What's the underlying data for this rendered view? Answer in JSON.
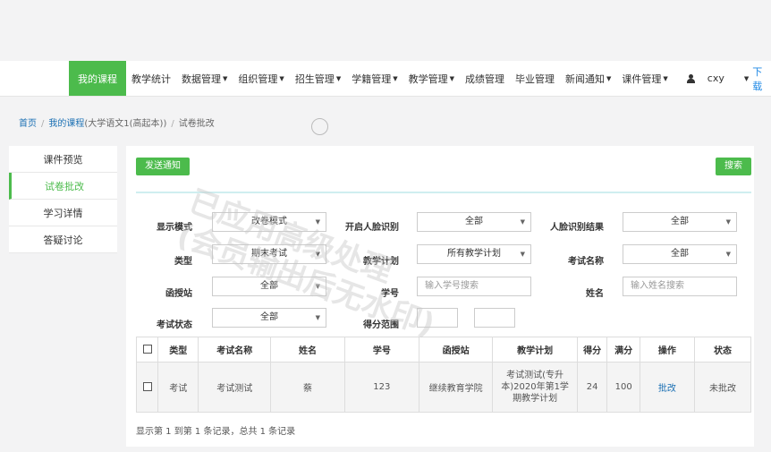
{
  "nav": {
    "items": [
      {
        "label": "我的课程",
        "caret": false,
        "active": true
      },
      {
        "label": "教学统计",
        "caret": false
      },
      {
        "label": "数据管理",
        "caret": true
      },
      {
        "label": "组织管理",
        "caret": true
      },
      {
        "label": "招生管理",
        "caret": true
      },
      {
        "label": "学籍管理",
        "caret": true
      },
      {
        "label": "教学管理",
        "caret": true
      },
      {
        "label": "成绩管理",
        "caret": false
      },
      {
        "label": "毕业管理",
        "caret": false
      },
      {
        "label": "新闻通知",
        "caret": true
      },
      {
        "label": "课件管理",
        "caret": true
      }
    ],
    "username": "cxy",
    "download": "下载"
  },
  "breadcrumb": {
    "home": "首页",
    "course": "我的课程",
    "course_detail": "(大学语文1(高起本))",
    "current": "试卷批改"
  },
  "sidebar": {
    "items": [
      "课件预览",
      "试卷批改",
      "学习详情",
      "答疑讨论"
    ],
    "active_index": 1
  },
  "toolbar": {
    "notify_label": "发送通知",
    "search_label": "搜索"
  },
  "filters": {
    "display_mode": {
      "label": "显示模式",
      "value": "改卷模式"
    },
    "face_enabled": {
      "label": "开启人脸识别",
      "value": "全部"
    },
    "face_result": {
      "label": "人脸识别结果",
      "value": "全部"
    },
    "type": {
      "label": "类型",
      "value": "期末考试"
    },
    "plan": {
      "label": "教学计划",
      "value": "所有教学计划"
    },
    "exam_name": {
      "label": "考试名称",
      "value": "全部"
    },
    "station": {
      "label": "函授站",
      "value": "全部"
    },
    "student_no": {
      "label": "学号",
      "placeholder": "输入学号搜索"
    },
    "name": {
      "label": "姓名",
      "placeholder": "输入姓名搜索"
    },
    "exam_status": {
      "label": "考试状态",
      "value": "全部"
    },
    "score_range": {
      "label": "得分范围"
    }
  },
  "table": {
    "headers": [
      "类型",
      "考试名称",
      "姓名",
      "学号",
      "函授站",
      "教学计划",
      "得分",
      "满分",
      "操作",
      "状态"
    ],
    "rows": [
      {
        "type": "考试",
        "exam_name": "考试测试",
        "name": "蔡",
        "student_no": "123",
        "station": "继续教育学院",
        "plan": "考试测试(专升本)2020年第1学期教学计划",
        "score": "24",
        "full": "100",
        "action": "批改",
        "status": "未批改"
      }
    ]
  },
  "footer": "显示第 1 到第 1 条记录，总共 1 条记录",
  "watermark": {
    "line1": "已应用高级处理",
    "line2": "(会员输出后无水印)"
  }
}
